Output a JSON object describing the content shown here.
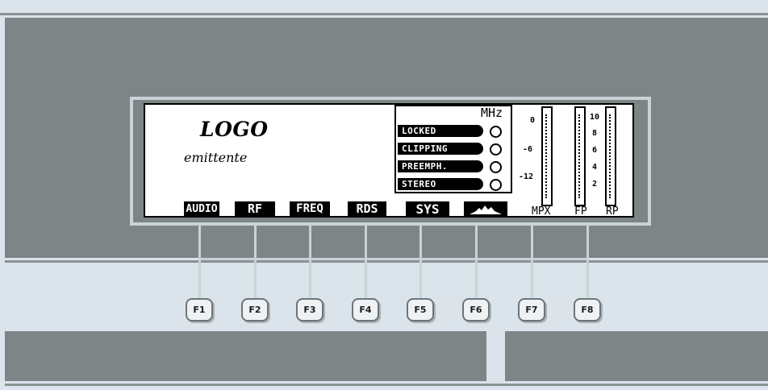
{
  "display": {
    "logo": "LOGO",
    "station": "emittente",
    "unit": "MHz"
  },
  "status": [
    {
      "label": "LOCKED"
    },
    {
      "label": "CLIPPING"
    },
    {
      "label": "PREEMPH."
    },
    {
      "label": "STEREO"
    }
  ],
  "meters": {
    "mpx_scale": [
      "0",
      "-6",
      "-12"
    ],
    "fp_rp_scale": [
      "10",
      "8",
      "6",
      "4",
      "2"
    ],
    "labels": [
      "MPX",
      "FP",
      "RP"
    ]
  },
  "tabs": [
    "AUDIO",
    "RF",
    "FREQ",
    "RDS",
    "SYS"
  ],
  "tab6_icon": "spectrum-icon",
  "fkeys": [
    "F1",
    "F2",
    "F3",
    "F4",
    "F5",
    "F6",
    "F7",
    "F8"
  ],
  "colors": {
    "panel": "#7e8587",
    "background": "#dbe4ea",
    "lcd": "#ffffff",
    "lcd_ink": "#000000"
  }
}
